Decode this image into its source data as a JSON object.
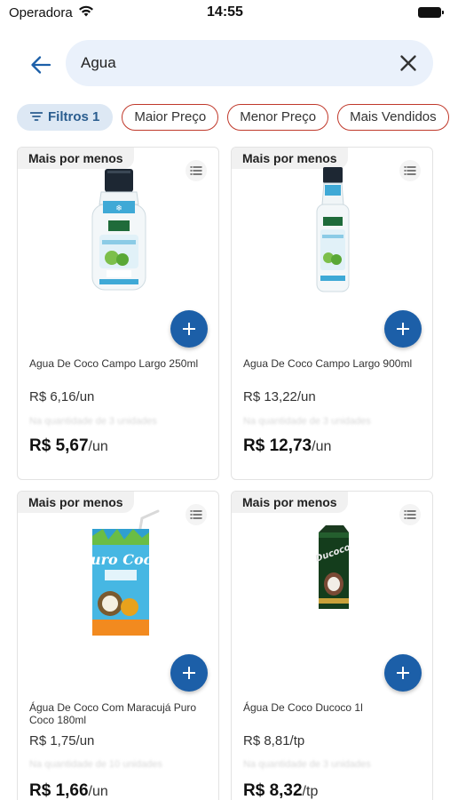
{
  "status_bar": {
    "carrier": "Operadora",
    "time": "14:55"
  },
  "search": {
    "query": "Agua",
    "back_icon": "arrow-left-icon",
    "clear_icon": "close-icon"
  },
  "filters": {
    "filter_chip": "Filtros 1",
    "sort_chips": [
      "Maior Preço",
      "Menor Preço",
      "Mais Vendidos"
    ]
  },
  "colors": {
    "accent": "#1c5fa8",
    "chip_outline": "#c0392b",
    "filter_chip_bg": "#dde8f4",
    "search_bg": "#eaf1fb"
  },
  "products": [
    {
      "badge": "Mais por menos",
      "name": "Agua De Coco Campo Largo 250ml",
      "unit_price": "R$ 6,16/un",
      "note": "Na quantidade de 3 unidades",
      "final_price": "R$ 5,67",
      "final_unit": "/un"
    },
    {
      "badge": "Mais por menos",
      "name": "Agua De Coco Campo Largo 900ml",
      "unit_price": "R$ 13,22/un",
      "note": "Na quantidade de 3 unidades",
      "final_price": "R$ 12,73",
      "final_unit": "/un"
    },
    {
      "badge": "Mais por menos",
      "name": "Água De Coco Com Maracujá Puro Coco 180ml",
      "unit_price": "R$ 1,75/un",
      "note": "Na quantidade de 10 unidades",
      "final_price": "R$ 1,66",
      "final_unit": "/un",
      "brand": "Puro Coco"
    },
    {
      "badge": "Mais por menos",
      "name": "Água De Coco Ducoco 1l",
      "unit_price": "R$ 8,81/tp",
      "note": "Na quantidade de 3 unidades",
      "final_price": "R$ 8,32",
      "final_unit": "/tp",
      "brand": "Ducoco"
    }
  ]
}
